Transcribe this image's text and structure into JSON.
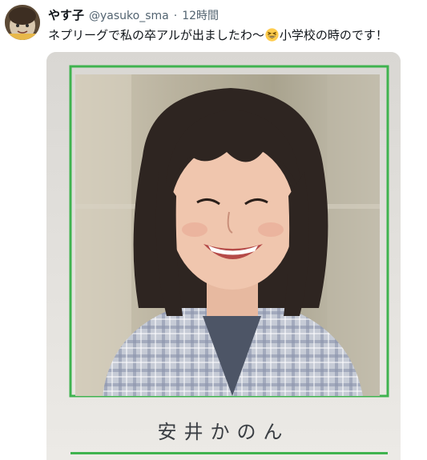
{
  "tweet": {
    "display_name": "やす子",
    "handle": "@yasuko_sma",
    "separator": "·",
    "time": "12時間",
    "text_before": "ネプリーグで私の卒アルが出ましたわ〜",
    "emoji": "grinning-squinting-face-icon",
    "text_after": "小学校の時のです！"
  },
  "media": {
    "caption": "安井かのん",
    "frame_color": "#3fb34f",
    "page_color": "#e4e2de"
  }
}
